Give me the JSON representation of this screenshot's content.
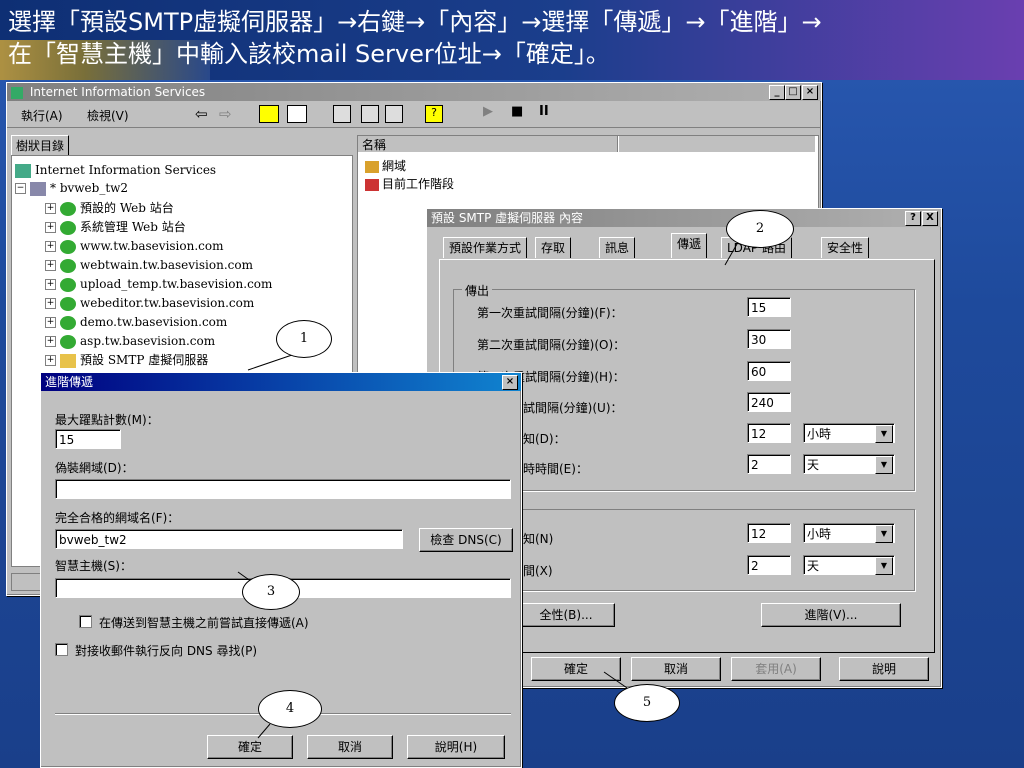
{
  "slide": {
    "line1": "選擇「預設SMTP虛擬伺服器」→右鍵→「內容」→選擇「傳遞」→「進階」→",
    "line2": "在「智慧主機」中輸入該校mail Server位址→「確定」。"
  },
  "iis": {
    "title": "Internet Information Services",
    "menu": {
      "action": "執行(A)",
      "view": "檢視(V)"
    },
    "tree_tab": "樹狀目錄",
    "col_name": "名稱",
    "right_items": [
      "網域",
      "目前工作階段"
    ],
    "tree": {
      "root": "Internet Information Services",
      "server": "* bvweb_tw2",
      "items": [
        "預設的 Web 站台",
        "系統管理 Web 站台",
        "www.tw.basevision.com",
        "webtwain.tw.basevision.com",
        "upload_temp.tw.basevision.com",
        "webeditor.tw.basevision.com",
        "demo.tw.basevision.com",
        "asp.tw.basevision.com",
        "預設 SMTP 虛擬伺服器"
      ]
    }
  },
  "props": {
    "title": "預設 SMTP 虛擬伺服器 內容",
    "help_btn": "?",
    "close_btn": "X",
    "tabs": [
      "預設作業方式",
      "存取",
      "訊息",
      "傳遞",
      "LDAP 路由",
      "安全性"
    ],
    "outbound_group": "傳出",
    "rows": [
      {
        "label": "第一次重試間隔(分鐘)(F)：",
        "value": "15"
      },
      {
        "label": "第二次重試間隔(分鐘)(O)：",
        "value": "30"
      },
      {
        "label": "第三次重試間隔(分鐘)(H)：",
        "value": "60"
      },
      {
        "label": "試間隔(分鐘)(U)：",
        "value": "240"
      },
      {
        "label": "知(D)：",
        "value": "12",
        "unit": "小時"
      },
      {
        "label": "時時間(E)：",
        "value": "2",
        "unit": "天"
      }
    ],
    "rows2": [
      {
        "label": "知(N)",
        "value": "12",
        "unit": "小時"
      },
      {
        "label": "間(X)",
        "value": "2",
        "unit": "天"
      }
    ],
    "security_btn": "全性(B)...",
    "advanced_btn": "進階(V)...",
    "ok": "確定",
    "cancel": "取消",
    "apply": "套用(A)",
    "help": "說明"
  },
  "adv": {
    "title": "進階傳遞",
    "max_hop_label": "最大躍點計數(M)：",
    "max_hop_value": "15",
    "masq_label": "偽裝網域(D)：",
    "masq_value": "",
    "fqdn_label": "完全合格的網域名(F)：",
    "fqdn_value": "bvweb_tw2",
    "check_dns": "檢查 DNS(C)",
    "smarthost_label": "智慧主機(S)：",
    "smarthost_value": "",
    "cb1": "在傳送到智慧主機之前嘗試直接傳遞(A)",
    "cb2": "對接收郵件執行反向 DNS 尋找(P)",
    "ok": "確定",
    "cancel": "取消",
    "help": "說明(H)"
  },
  "callouts": [
    "1",
    "2",
    "3",
    "4",
    "5"
  ],
  "colors": {
    "titlebar": "#000080",
    "window": "#c0c0c0",
    "desktop": "#1f4da0"
  }
}
